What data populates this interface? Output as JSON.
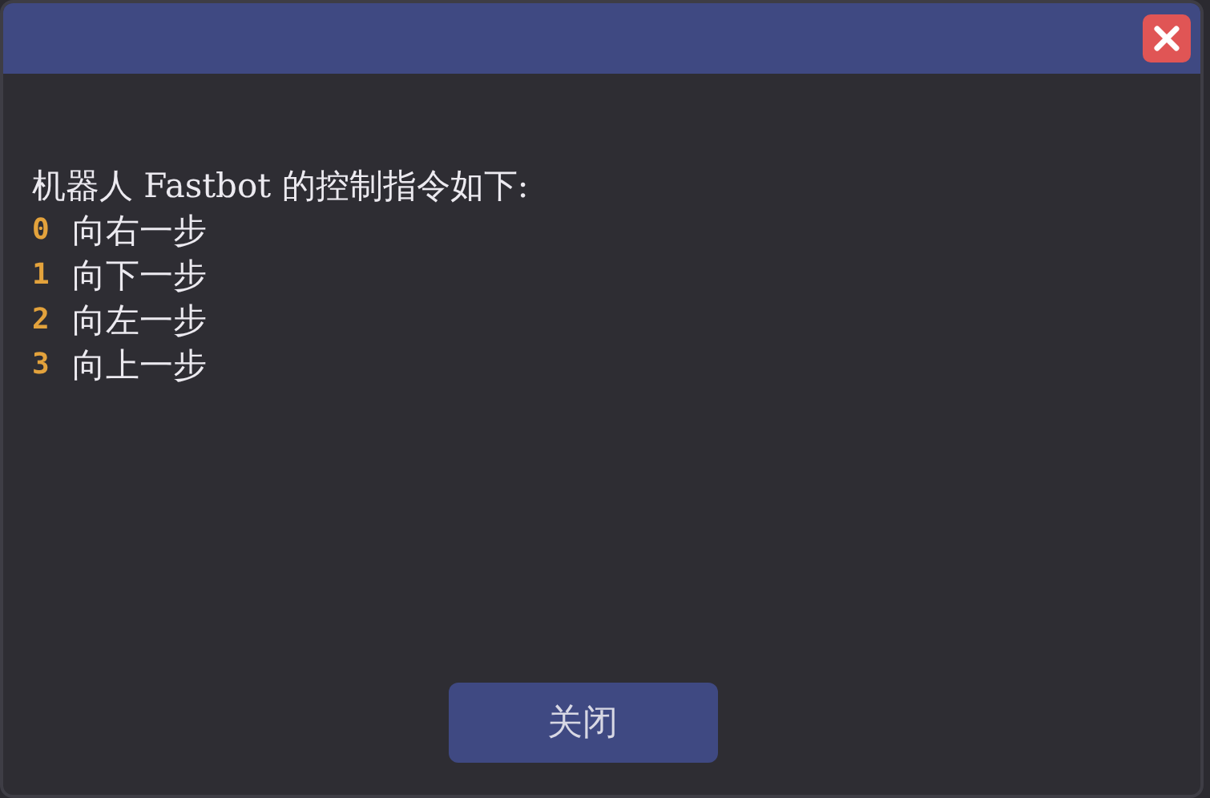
{
  "dialog": {
    "message": "机器人 Fastbot 的控制指令如下:",
    "commands": [
      {
        "key": "0",
        "action": "向右一步"
      },
      {
        "key": "1",
        "action": "向下一步"
      },
      {
        "key": "2",
        "action": "向左一步"
      },
      {
        "key": "3",
        "action": "向上一步"
      }
    ],
    "button": "关闭"
  }
}
